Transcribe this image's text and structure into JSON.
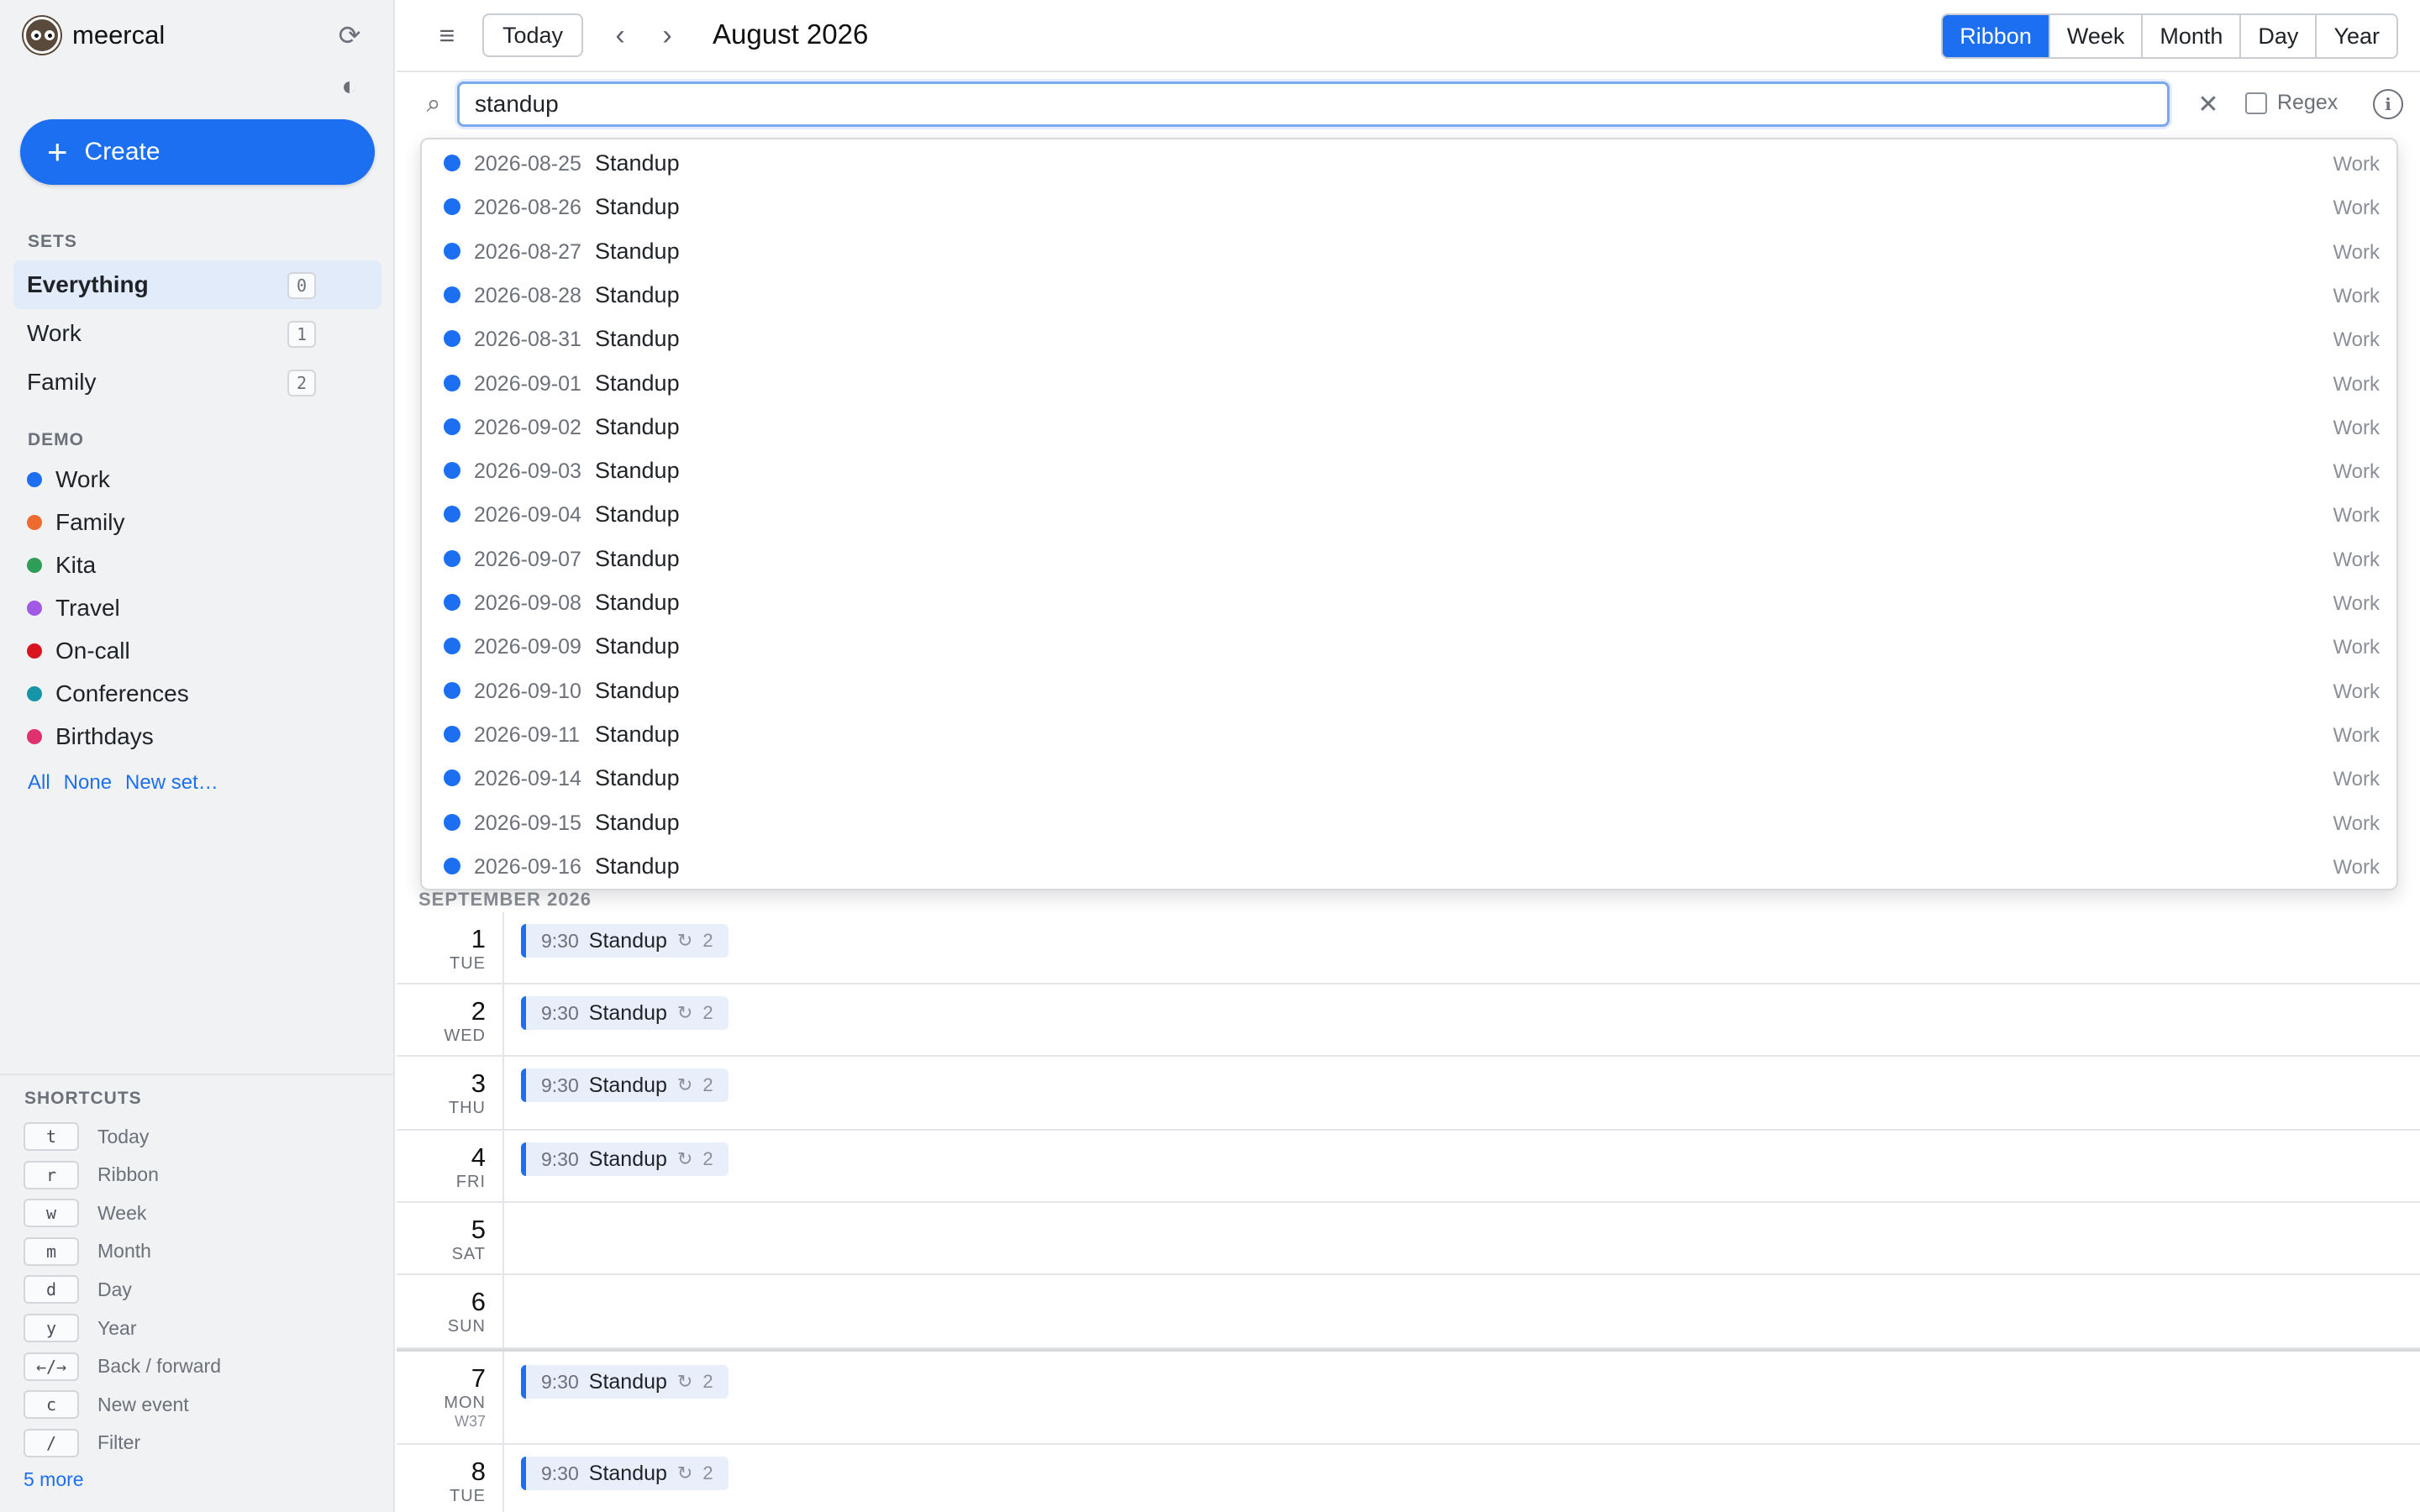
{
  "app": {
    "name": "meercal"
  },
  "sidebar": {
    "create_label": "Create",
    "sets_label": "SETS",
    "sets": [
      {
        "label": "Everything",
        "count": "0",
        "active": true
      },
      {
        "label": "Work",
        "count": "1",
        "active": false
      },
      {
        "label": "Family",
        "count": "2",
        "active": false
      }
    ],
    "demo_label": "DEMO",
    "calendars": [
      {
        "label": "Work",
        "color": "#1c6ff0"
      },
      {
        "label": "Family",
        "color": "#ef6a2e"
      },
      {
        "label": "Kita",
        "color": "#2f9e58"
      },
      {
        "label": "Travel",
        "color": "#a259e6"
      },
      {
        "label": "On-call",
        "color": "#d9141e"
      },
      {
        "label": "Conferences",
        "color": "#1795a8"
      },
      {
        "label": "Birthdays",
        "color": "#e0306e"
      }
    ],
    "links": {
      "all": "All",
      "none": "None",
      "new_set": "New set…"
    },
    "shortcuts_label": "SHORTCUTS",
    "shortcuts": [
      {
        "key": "t",
        "label": "Today"
      },
      {
        "key": "r",
        "label": "Ribbon"
      },
      {
        "key": "w",
        "label": "Week"
      },
      {
        "key": "m",
        "label": "Month"
      },
      {
        "key": "d",
        "label": "Day"
      },
      {
        "key": "y",
        "label": "Year"
      },
      {
        "key": "←/→",
        "label": "Back / forward"
      },
      {
        "key": "c",
        "label": "New event"
      },
      {
        "key": "/",
        "label": "Filter"
      }
    ],
    "more_link": "5 more"
  },
  "toolbar": {
    "today_label": "Today",
    "title": "August 2026",
    "views": [
      {
        "label": "Ribbon",
        "active": true
      },
      {
        "label": "Week",
        "active": false
      },
      {
        "label": "Month",
        "active": false
      },
      {
        "label": "Day",
        "active": false
      },
      {
        "label": "Year",
        "active": false
      }
    ]
  },
  "search": {
    "value": "standup",
    "regex_label": "Regex",
    "results": [
      {
        "date": "2026-08-25",
        "title": "Standup",
        "calendar": "Work"
      },
      {
        "date": "2026-08-26",
        "title": "Standup",
        "calendar": "Work"
      },
      {
        "date": "2026-08-27",
        "title": "Standup",
        "calendar": "Work"
      },
      {
        "date": "2026-08-28",
        "title": "Standup",
        "calendar": "Work"
      },
      {
        "date": "2026-08-31",
        "title": "Standup",
        "calendar": "Work"
      },
      {
        "date": "2026-09-01",
        "title": "Standup",
        "calendar": "Work"
      },
      {
        "date": "2026-09-02",
        "title": "Standup",
        "calendar": "Work"
      },
      {
        "date": "2026-09-03",
        "title": "Standup",
        "calendar": "Work"
      },
      {
        "date": "2026-09-04",
        "title": "Standup",
        "calendar": "Work"
      },
      {
        "date": "2026-09-07",
        "title": "Standup",
        "calendar": "Work"
      },
      {
        "date": "2026-09-08",
        "title": "Standup",
        "calendar": "Work"
      },
      {
        "date": "2026-09-09",
        "title": "Standup",
        "calendar": "Work"
      },
      {
        "date": "2026-09-10",
        "title": "Standup",
        "calendar": "Work"
      },
      {
        "date": "2026-09-11",
        "title": "Standup",
        "calendar": "Work"
      },
      {
        "date": "2026-09-14",
        "title": "Standup",
        "calendar": "Work"
      },
      {
        "date": "2026-09-15",
        "title": "Standup",
        "calendar": "Work"
      },
      {
        "date": "2026-09-16",
        "title": "Standup",
        "calendar": "Work"
      }
    ]
  },
  "ribbon": {
    "month_label": "SEPTEMBER 2026",
    "days": [
      {
        "num": "1",
        "name": "TUE",
        "week": "",
        "event": {
          "time": "9:30",
          "title": "Standup",
          "repeat": "2"
        }
      },
      {
        "num": "2",
        "name": "WED",
        "week": "",
        "event": {
          "time": "9:30",
          "title": "Standup",
          "repeat": "2"
        }
      },
      {
        "num": "3",
        "name": "THU",
        "week": "",
        "event": {
          "time": "9:30",
          "title": "Standup",
          "repeat": "2"
        }
      },
      {
        "num": "4",
        "name": "FRI",
        "week": "",
        "event": {
          "time": "9:30",
          "title": "Standup",
          "repeat": "2"
        }
      },
      {
        "num": "5",
        "name": "SAT",
        "week": "",
        "event": null
      },
      {
        "num": "6",
        "name": "SUN",
        "week": "",
        "event": null
      },
      {
        "num": "7",
        "name": "MON",
        "week": "W37",
        "event": {
          "time": "9:30",
          "title": "Standup",
          "repeat": "2"
        }
      },
      {
        "num": "8",
        "name": "TUE",
        "week": "",
        "event": {
          "time": "9:30",
          "title": "Standup",
          "repeat": "2"
        }
      }
    ]
  }
}
